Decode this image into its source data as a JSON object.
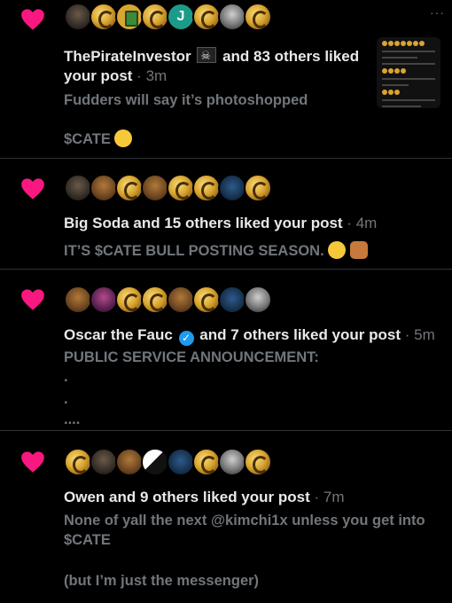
{
  "notifications": [
    {
      "actor": "ThePirateInvestor",
      "rest": "and 83 others liked your post",
      "time": "3m",
      "text1": "Fudders will say it’s photoshopped",
      "text2": "$CATE",
      "avatar_teal_letter": "J",
      "thumbnail_lines": [
        "ThePirateInvestor and 83 others liked your post",
        "Fudders will say it's photoshopped",
        "$CATE"
      ]
    },
    {
      "actor": "Big Soda",
      "rest": "and 15 others liked your post",
      "time": "4m",
      "text1": "IT’S $CATE BULL POSTING SEASON."
    },
    {
      "actor": "Oscar the Fauc",
      "rest": "and 7 others liked your post",
      "time": "5m",
      "text1": "PUBLIC SERVICE ANNOUNCEMENT:",
      "text2": ".",
      "text3": ".",
      "text4": "...."
    },
    {
      "actor": "Owen",
      "rest": "and 9 others liked your post",
      "time": "7m",
      "text1": "None of yall the next @kimchi1x unless you get into",
      "text2": "$CATE",
      "text3": "(but I’m just the messenger)"
    }
  ],
  "colors": {
    "heart": "#f91880",
    "muted": "#71767b",
    "divider": "#2f3336",
    "verified": "#1d9bf0"
  }
}
